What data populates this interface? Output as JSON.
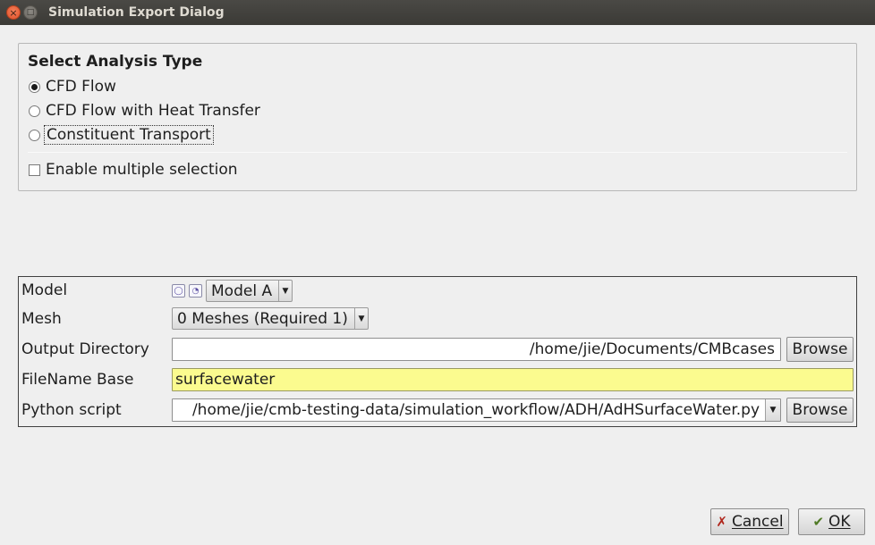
{
  "window": {
    "title": "Simulation Export Dialog",
    "close_glyph": "×",
    "max_glyph": "□"
  },
  "analysis": {
    "title": "Select Analysis Type",
    "options": [
      {
        "label": "CFD Flow",
        "selected": true
      },
      {
        "label": "CFD Flow with Heat Transfer",
        "selected": false
      },
      {
        "label": "Constituent Transport",
        "selected": false
      }
    ],
    "multi_select_label": "Enable multiple selection",
    "multi_select_checked": false
  },
  "form": {
    "model_label": "Model",
    "model_value": "Model A",
    "mesh_label": "Mesh",
    "mesh_value": "0 Meshes (Required 1)",
    "output_dir_label": "Output Directory",
    "output_dir_value": "/home/jie/Documents/CMBcases",
    "filename_label": "FileName Base",
    "filename_value": "surfacewater",
    "python_label": "Python script",
    "python_value": "/home/jie/cmb-testing-data/simulation_workflow/ADH/AdHSurfaceWater.py",
    "browse_label": "Browse",
    "dropdown_glyph": "▼"
  },
  "footer": {
    "cancel_label": "Cancel",
    "ok_label": "OK",
    "cancel_icon": "✗",
    "ok_icon": "✔"
  },
  "colors": {
    "titlebar": "#3c3b37",
    "close_button": "#e8582f",
    "required_field": "#fbfb8f"
  },
  "icons": {
    "close": "close-icon",
    "maximize": "maximize-icon",
    "model_view": "model-view-icon",
    "model_settings": "model-settings-icon",
    "cancel": "cancel-x-icon",
    "ok": "ok-check-icon"
  }
}
